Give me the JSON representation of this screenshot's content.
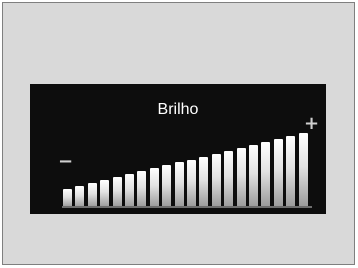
{
  "display": {
    "title": "Brilho",
    "minus_label": "−",
    "plus_label": "+",
    "level": {
      "current": 20,
      "max": 20
    }
  },
  "colors": {
    "panel_bg": "#d9d9d9",
    "display_bg": "#0d0d0d",
    "text": "#ffffff"
  }
}
